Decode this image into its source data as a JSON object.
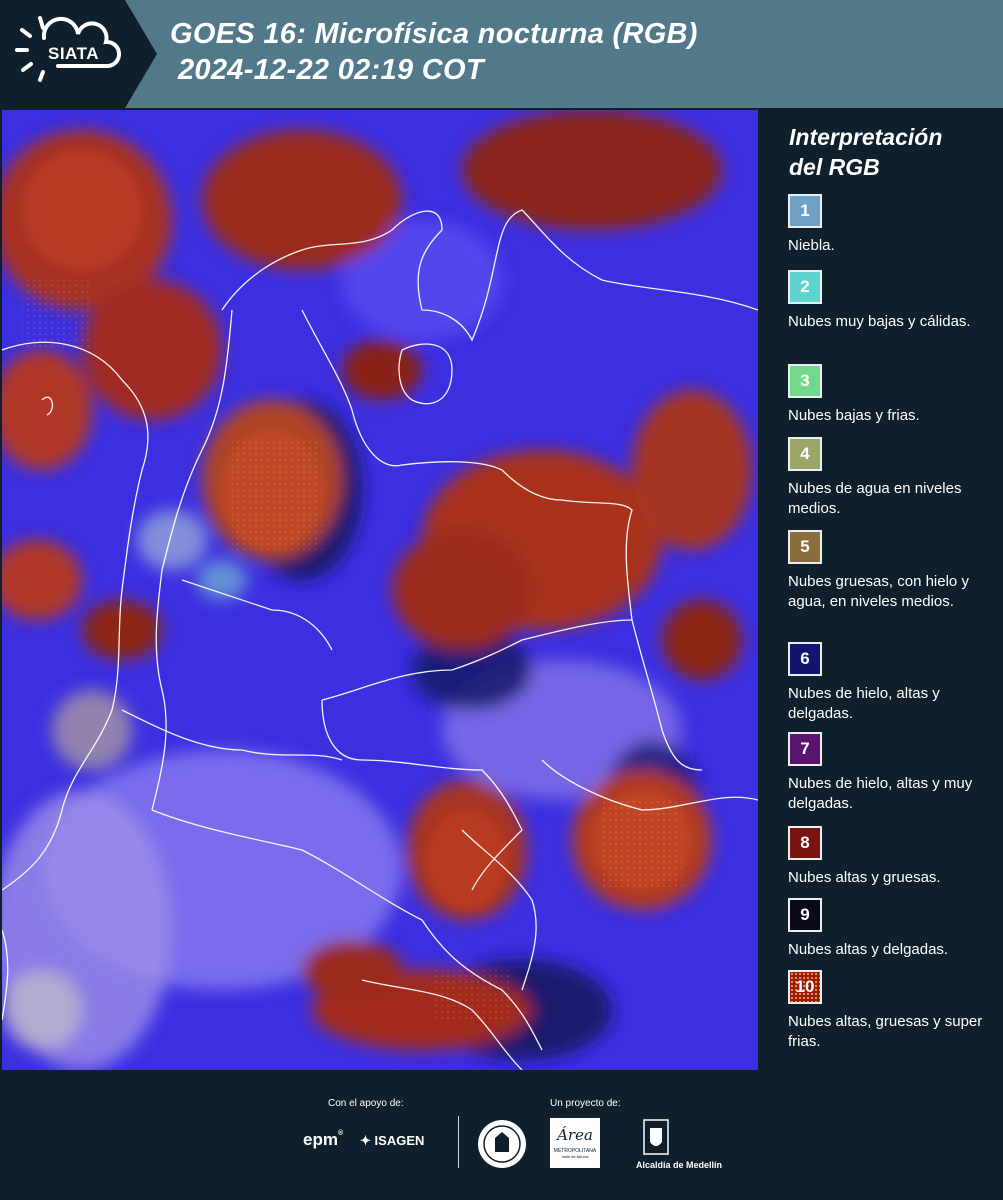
{
  "header": {
    "logo_text": "SIATA",
    "title_line1": "GOES 16: Microfísica nocturna (RGB)",
    "title_line2": "2024-12-22 02:19 COT",
    "background": "#51798a"
  },
  "legend": {
    "title_line1": "Interpretación",
    "title_line2": "del RGB",
    "items": [
      {
        "number": "1",
        "label": "Niebla.",
        "color": "#6ea0c8"
      },
      {
        "number": "2",
        "label": "Nubes muy bajas y cálidas.",
        "color": "#5fd3cf"
      },
      {
        "number": "3",
        "label": "Nubes bajas y frias.",
        "color": "#73d98a"
      },
      {
        "number": "4",
        "label": "Nubes de agua en niveles medios.",
        "color": "#9aa768"
      },
      {
        "number": "5",
        "label": "Nubes gruesas, con hielo y agua, en niveles medios.",
        "color": "#8c6e3e"
      },
      {
        "number": "6",
        "label": "Nubes de hielo, altas y delgadas.",
        "color": "#13146e"
      },
      {
        "number": "7",
        "label": "Nubes de hielo, altas y muy delgadas.",
        "color": "#5a1470"
      },
      {
        "number": "8",
        "label": "Nubes altas y gruesas.",
        "color": "#7a1410"
      },
      {
        "number": "9",
        "label": "Nubes altas y delgadas.",
        "color": "#0a0a18"
      },
      {
        "number": "10",
        "label": "Nubes altas, gruesas y super frias.",
        "color": "#9b1a10"
      }
    ]
  },
  "footer": {
    "support_label": "Con el apoyo de:",
    "project_label": "Un proyecto de:",
    "sponsor_epm": "epm",
    "sponsor_isagen": "ISAGEN",
    "logo_metropolitana": "METROPOLITANA",
    "logo_metropolitana_sub": "Valle de Aburrá",
    "logo_area": "Área",
    "logo_alcaldia": "Alcaldía de Medellín"
  }
}
